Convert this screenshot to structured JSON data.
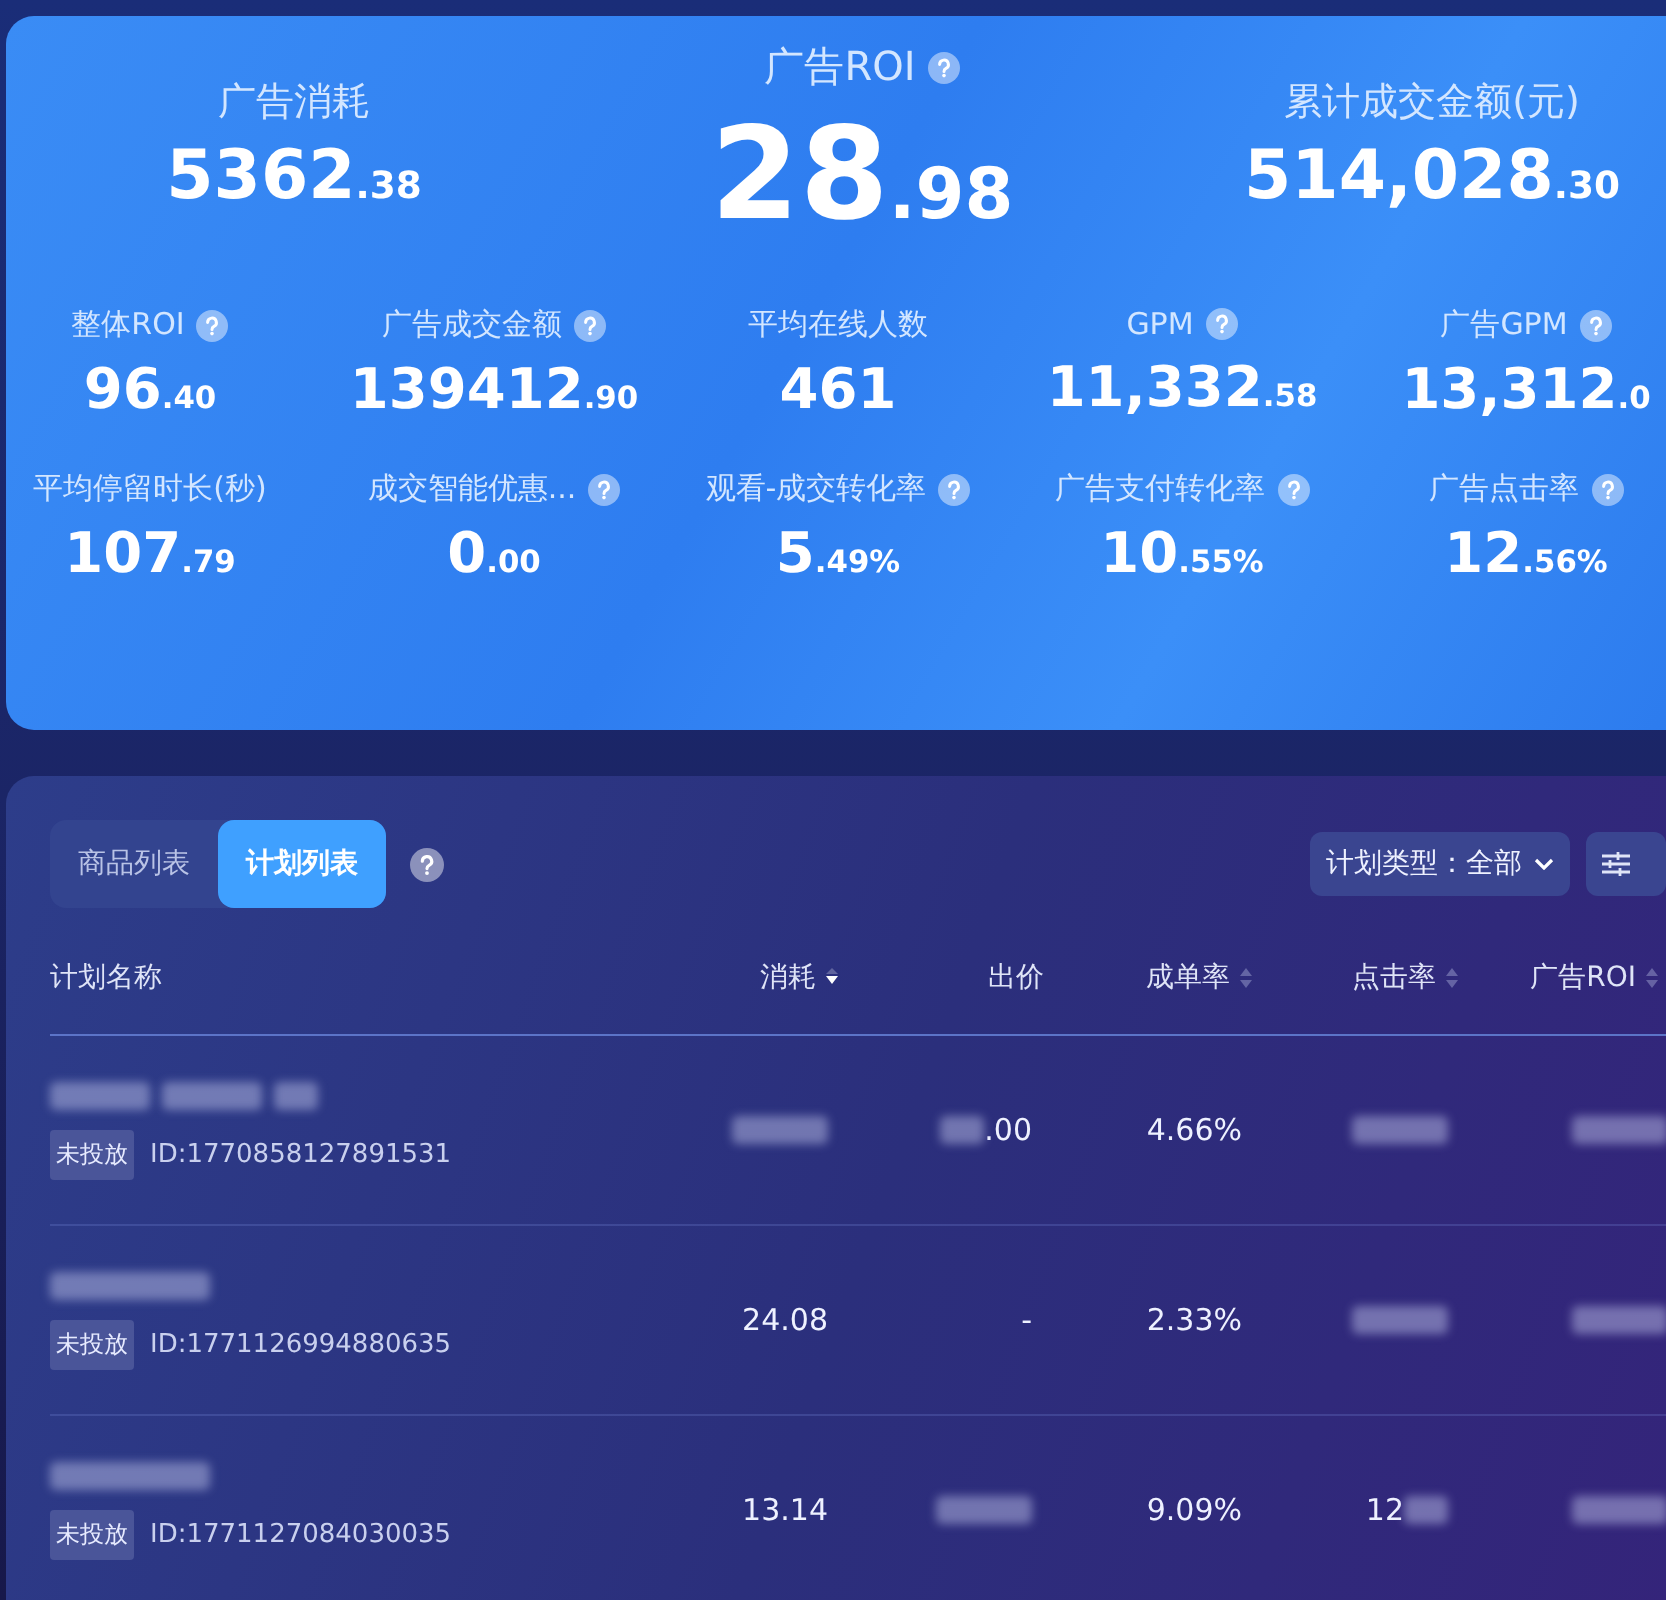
{
  "summary": {
    "headline": [
      {
        "label": "广告消耗",
        "value": "5362",
        "decimals": ".38",
        "help": false,
        "emphasis": false
      },
      {
        "label": "广告ROI",
        "value": "28",
        "decimals": ".98",
        "help": true,
        "emphasis": true
      },
      {
        "label": "累计成交金额(元)",
        "value": "514,028",
        "decimals": ".30",
        "help": false,
        "emphasis": false
      }
    ],
    "metrics": [
      {
        "label": "整体ROI",
        "value": "96",
        "decimals": ".40",
        "help": true
      },
      {
        "label": "广告成交金额",
        "value": "139412",
        "decimals": ".90",
        "help": true
      },
      {
        "label": "平均在线人数",
        "value": "461",
        "help": false
      },
      {
        "label": "GPM",
        "value": "11,332",
        "decimals": ".58",
        "help": true
      },
      {
        "label": "广告GPM",
        "value": "13,312",
        "decimals": ".0",
        "help": true
      },
      {
        "label": "平均停留时长(秒)",
        "value": "107",
        "decimals": ".79",
        "help": false
      },
      {
        "label": "成交智能优惠...",
        "value": "0",
        "decimals": ".00",
        "help": true
      },
      {
        "label": "观看-成交转化率",
        "value": "5",
        "decimals": ".49%",
        "help": true
      },
      {
        "label": "广告支付转化率",
        "value": "10",
        "decimals": ".55%",
        "help": true
      },
      {
        "label": "广告点击率",
        "value": "12",
        "decimals": ".56%",
        "help": true
      }
    ]
  },
  "list": {
    "tabs": [
      {
        "label": "商品列表",
        "selected": false
      },
      {
        "label": "计划列表",
        "selected": true
      }
    ],
    "filter": {
      "label": "计划类型：全部"
    },
    "table": {
      "columns": [
        {
          "label": "计划名称",
          "sortable": false
        },
        {
          "label": "消耗",
          "sortable": true,
          "sorted": true
        },
        {
          "label": "出价",
          "sortable": false
        },
        {
          "label": "成单率",
          "sortable": true,
          "sorted": false
        },
        {
          "label": "点击率",
          "sortable": true,
          "sorted": false
        },
        {
          "label": "广告ROI",
          "sortable": true,
          "sorted": false
        }
      ],
      "rows": [
        {
          "cells": [
            {
              "kind": "plan",
              "name": [
                {
                  "kind": "blur"
                },
                {
                  "kind": "blur"
                },
                {
                  "kind": "blur_small"
                }
              ],
              "status": "未投放",
              "id": "ID:1770858127891531"
            },
            {
              "kind": "value",
              "parts": [
                {
                  "kind": "blur"
                }
              ]
            },
            {
              "kind": "value",
              "parts": [
                {
                  "kind": "blur_small"
                },
                {
                  "kind": "text",
                  "text": ".00"
                }
              ]
            },
            {
              "kind": "value",
              "parts": [
                {
                  "kind": "text",
                  "text": "4.66%"
                }
              ]
            },
            {
              "kind": "value",
              "parts": [
                {
                  "kind": "blur"
                }
              ]
            },
            {
              "kind": "value",
              "parts": [
                {
                  "kind": "blur"
                }
              ]
            }
          ]
        },
        {
          "cells": [
            {
              "kind": "plan",
              "name": [
                {
                  "kind": "blur"
                }
              ],
              "status": "未投放",
              "id": "ID:1771126994880635"
            },
            {
              "kind": "value",
              "parts": [
                {
                  "kind": "text",
                  "text": "24.08"
                }
              ]
            },
            {
              "kind": "value",
              "parts": [
                {
                  "kind": "text",
                  "text": "-"
                }
              ]
            },
            {
              "kind": "value",
              "parts": [
                {
                  "kind": "text",
                  "text": "2.33%"
                }
              ]
            },
            {
              "kind": "value",
              "parts": [
                {
                  "kind": "blur"
                }
              ]
            },
            {
              "kind": "value",
              "parts": [
                {
                  "kind": "blur"
                }
              ]
            }
          ]
        },
        {
          "cells": [
            {
              "kind": "plan",
              "name": [
                {
                  "kind": "blur"
                }
              ],
              "status": "未投放",
              "id": "ID:1771127084030035"
            },
            {
              "kind": "value",
              "parts": [
                {
                  "kind": "text",
                  "text": "13.14"
                }
              ]
            },
            {
              "kind": "value",
              "parts": [
                {
                  "kind": "blur"
                }
              ]
            },
            {
              "kind": "value",
              "parts": [
                {
                  "kind": "text",
                  "text": "9.09%"
                }
              ]
            },
            {
              "kind": "value",
              "parts": [
                {
                  "kind": "text",
                  "text": "12"
                },
                {
                  "kind": "blur_small"
                }
              ]
            },
            {
              "kind": "value",
              "parts": [
                {
                  "kind": "blur"
                }
              ]
            }
          ]
        }
      ]
    }
  }
}
